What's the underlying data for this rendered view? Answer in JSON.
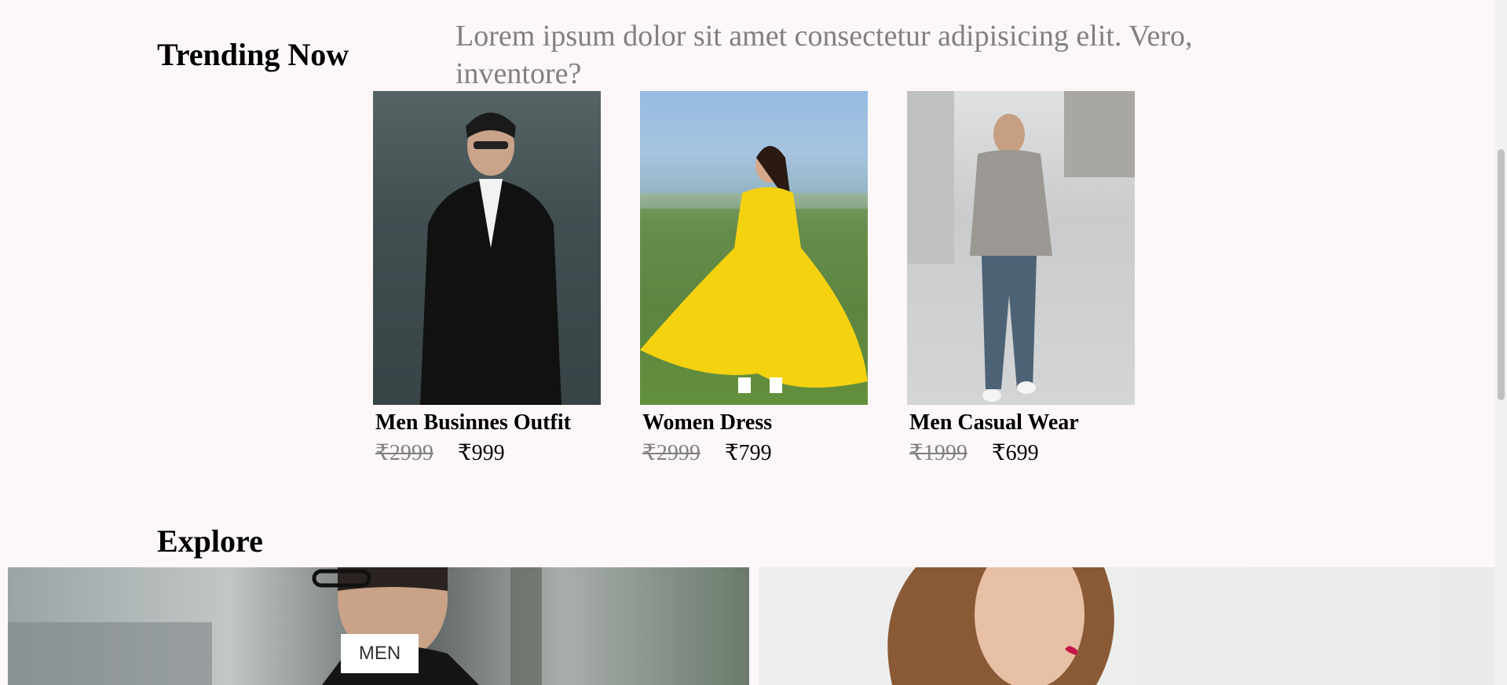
{
  "trending": {
    "title": "Trending Now",
    "tagline": "Lorem ipsum dolor sit amet consectetur adipisicing elit. Vero, inventore?",
    "products": [
      {
        "name": "Men Businnes Outfit",
        "old_price": "₹2999",
        "new_price": "₹999"
      },
      {
        "name": "Women Dress",
        "old_price": "₹2999",
        "new_price": "₹799"
      },
      {
        "name": "Men Casual Wear",
        "old_price": "₹1999",
        "new_price": "₹699"
      }
    ]
  },
  "explore": {
    "title": "Explore",
    "men_label": "MEN"
  }
}
